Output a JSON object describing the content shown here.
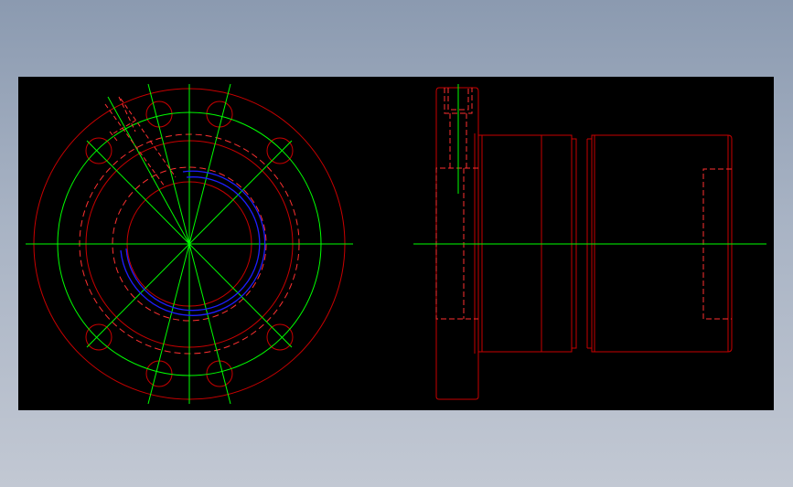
{
  "drawing": {
    "background": "#000000",
    "colors": {
      "outline": "#c80000",
      "hidden": "#ff3030",
      "center": "#00ff00",
      "thread": "#1e1eff"
    },
    "views": [
      "front-view",
      "side-view"
    ]
  }
}
